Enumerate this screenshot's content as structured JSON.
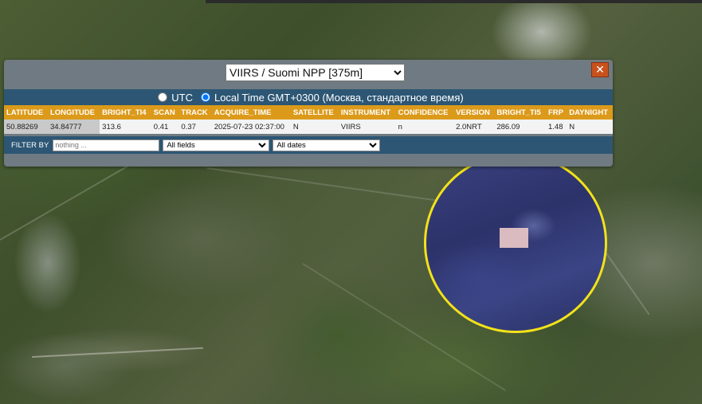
{
  "popup": {
    "sensor_selected": "VIIRS / Suomi NPP [375m]",
    "close_symbol": "✕",
    "time_options": {
      "utc_label": "UTC",
      "local_label": "Local Time GMT+0300 (Москва, стандартное время)"
    },
    "table": {
      "headers": [
        "LATITUDE",
        "LONGITUDE",
        "BRIGHT_TI4",
        "SCAN",
        "TRACK",
        "ACQUIRE_TIME",
        "SATELLITE",
        "INSTRUMENT",
        "CONFIDENCE",
        "VERSION",
        "BRIGHT_TI5",
        "FRP",
        "DAYNIGHT"
      ],
      "rows": [
        [
          "50.88269",
          "34.84777",
          "313.6",
          "0.41",
          "0.37",
          "2025-07-23 02:37:00",
          "N",
          "VIIRS",
          "n",
          "2.0NRT",
          "286.09",
          "1.48",
          "N"
        ]
      ]
    },
    "filter": {
      "label": "FILTER BY",
      "placeholder": "nothing ...",
      "field_selected": "All fields",
      "date_selected": "All dates"
    }
  },
  "colors": {
    "header_bar": "#2c5674",
    "table_header": "#dc9a1a",
    "close_button": "#c8511c",
    "detection_ring": "#f2e21a"
  }
}
